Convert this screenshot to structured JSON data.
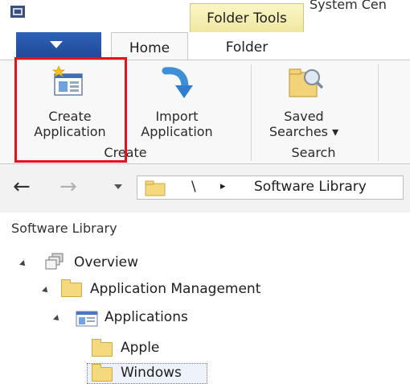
{
  "titlebar": {
    "contextual_tab": "Folder Tools",
    "window_title": "System Cen"
  },
  "tabs": {
    "home": "Home",
    "folder": "Folder"
  },
  "ribbon": {
    "create_application": [
      "Create",
      "Application"
    ],
    "import_application": [
      "Import",
      "Application"
    ],
    "saved_searches": [
      "Saved",
      "Searches ▾"
    ],
    "group_create": "Create",
    "group_search": "Search"
  },
  "address": {
    "path_sep": "\\",
    "crumb_arrow": "▸",
    "location": "Software Library"
  },
  "tree": {
    "header": "Software Library",
    "items": [
      {
        "label": "Overview"
      },
      {
        "label": "Application Management"
      },
      {
        "label": "Applications"
      },
      {
        "label": "Apple"
      },
      {
        "label": "Windows"
      }
    ]
  },
  "colors": {
    "file_tab": "#2a5db0",
    "contextual_tab": "#f4eaa6",
    "highlight": "#e8101a"
  }
}
